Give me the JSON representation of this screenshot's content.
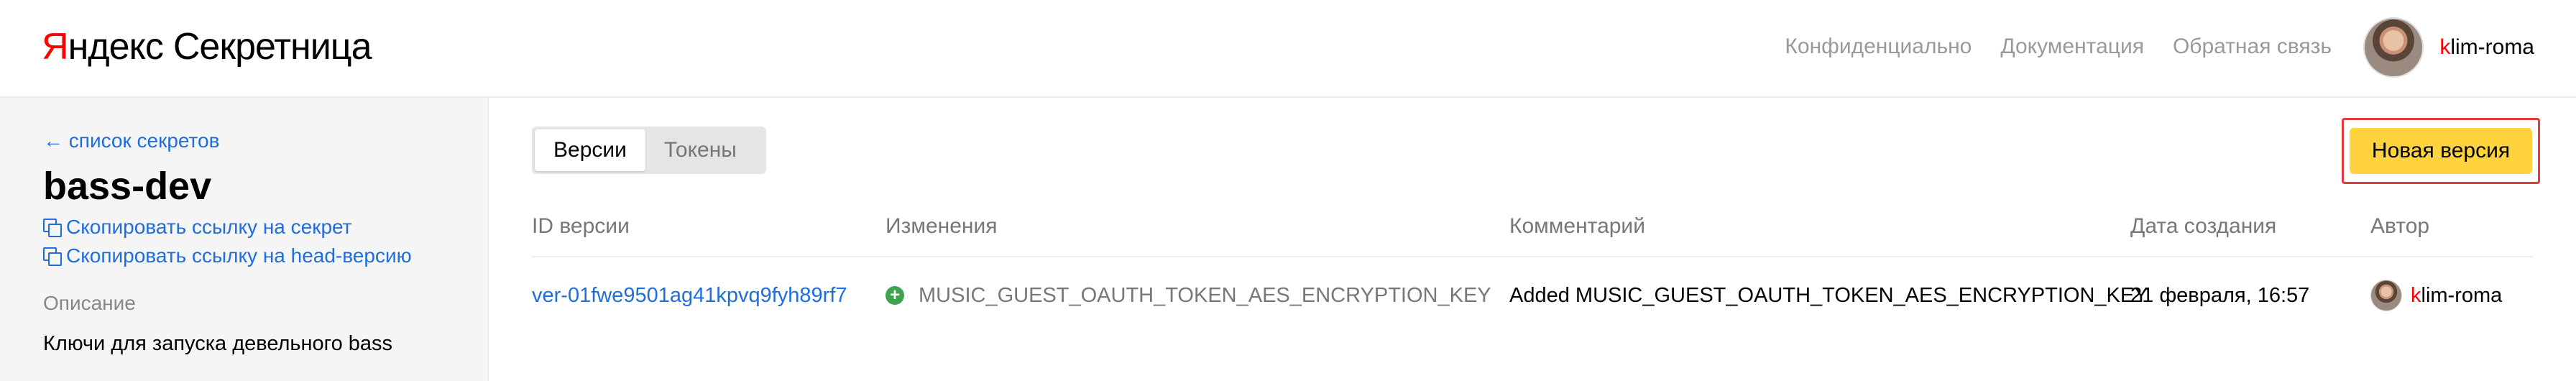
{
  "header": {
    "logo_brand_ya": "Я",
    "logo_brand_rest": "ндекс",
    "logo_product": "Секретница",
    "nav": [
      {
        "label": "Конфиденциально"
      },
      {
        "label": "Документация"
      },
      {
        "label": "Обратная связь"
      }
    ],
    "user": {
      "name_first": "k",
      "name_rest": "lim-roma"
    }
  },
  "sidebar": {
    "back_link": "← список секретов",
    "secret_title": "bass-dev",
    "copy_secret_link": "Скопировать ссылку на секрет",
    "copy_head_link": "Скопировать ссылку на head-версию",
    "description_label": "Описание",
    "description_value": "Ключи для запуска девельного bass"
  },
  "main": {
    "tabs": [
      {
        "label": "Версии",
        "active": true
      },
      {
        "label": "Токены",
        "active": false
      }
    ],
    "new_version_button": "Новая версия",
    "table": {
      "headers": [
        "ID версии",
        "Изменения",
        "Комментарий",
        "Дата создания",
        "Автор"
      ],
      "rows": [
        {
          "version_id": "ver-01fwe9501ag41kpvq9fyh89rf7",
          "change": "MUSIC_GUEST_OAUTH_TOKEN_AES_ENCRYPTION_KEY",
          "comment": "Added MUSIC_GUEST_OAUTH_TOKEN_AES_ENCRYPTION_KEY",
          "created": "21 февраля, 16:57",
          "author_first": "k",
          "author_rest": "lim-roma"
        }
      ]
    }
  },
  "colors": {
    "accent_link": "#1f6edb",
    "button_yellow": "#ffd33d",
    "highlight_border": "#e03a3a",
    "added_green": "#3fa34d"
  }
}
